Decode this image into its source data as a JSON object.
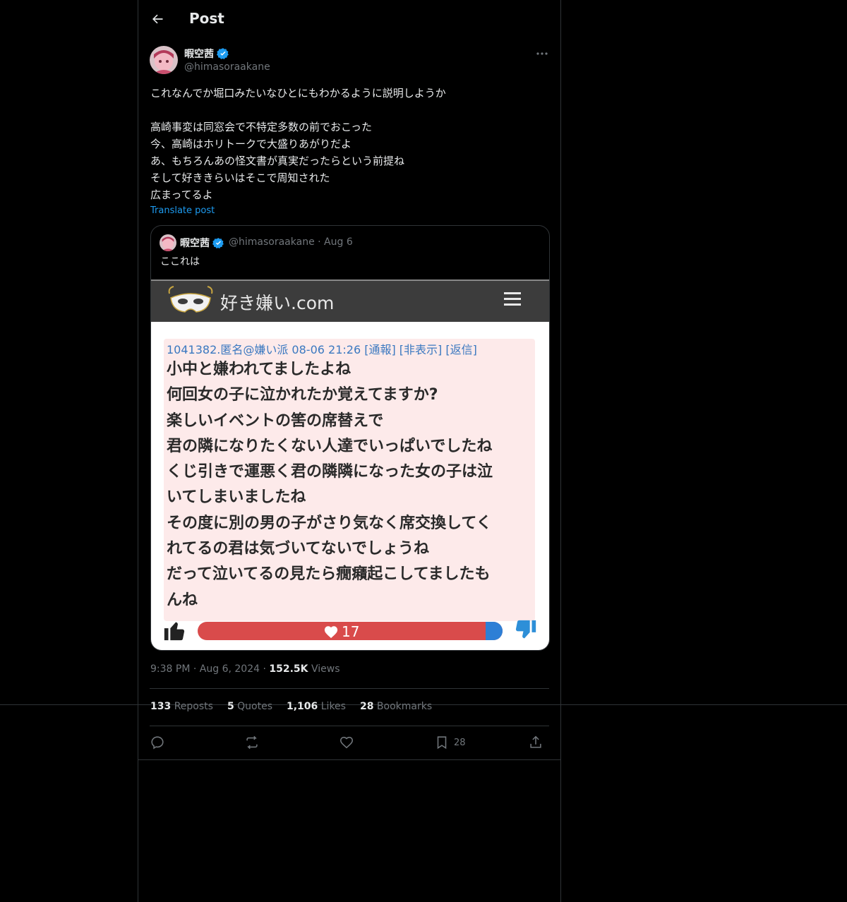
{
  "header": {
    "title": "Post"
  },
  "author": {
    "name": "暇空茜",
    "handle": "@himasoraakane"
  },
  "tweet": {
    "lines": [
      "これなんでか堀口みたいなひとにもわかるように説明しようか",
      "",
      "高崎事変は同窓会で不特定多数の前でおこった",
      "今、高崎はホリトークで大盛りあがりだよ",
      "あ、もちろんあの怪文書が真実だったらという前提ね",
      "そして好ききらいはそこで周知された",
      "広まってるよ"
    ],
    "translate_label": "Translate post"
  },
  "quote": {
    "name": "暇空茜",
    "handle": "@himasoraakane",
    "date": "· Aug 6",
    "text": "ここれは",
    "image": {
      "site_name": "好き嫌い.com",
      "post_meta": "1041382.匿名@嫌い派 08-06 21:26 [通報] [非表示] [返信]",
      "post_lines": [
        "小中と嫌われてましたよね",
        "何回女の子に泣かれたか覚えてますか?",
        "楽しいイベントの筈の席替えで",
        "君の隣になりたくない人達でいっぱいでしたね",
        "くじ引きで運悪く君の隣隣になった女の子は泣",
        "いてしまいましたね",
        "その度に別の男の子がさり気なく席交換してく",
        "れてるの君は気づいてないでしょうね",
        "だって泣いてるの見たら癇癪起こしてましたも",
        "んね"
      ],
      "vote_count": "17"
    }
  },
  "meta": {
    "time": "9:38 PM",
    "date": "Aug 6, 2024",
    "views_count": "152.5K",
    "views_label": "Views"
  },
  "stats": {
    "reposts_count": "133",
    "reposts_label": "Reposts",
    "quotes_count": "5",
    "quotes_label": "Quotes",
    "likes_count": "1,106",
    "likes_label": "Likes",
    "bookmarks_count": "28",
    "bookmarks_label": "Bookmarks"
  },
  "actions": {
    "bookmark_count": "28"
  },
  "icons": {
    "back": "arrow-left-icon",
    "verified": "verified-badge-icon",
    "more": "more-icon",
    "reply": "reply-icon",
    "repost": "repost-icon",
    "like": "heart-icon",
    "bookmark": "bookmark-icon",
    "share": "share-icon"
  },
  "colors": {
    "background": "#000000",
    "text": "#e7e9ea",
    "muted": "#71767b",
    "link": "#1d9bf0",
    "border": "#2f3336",
    "verified": "#1d9bf0"
  }
}
